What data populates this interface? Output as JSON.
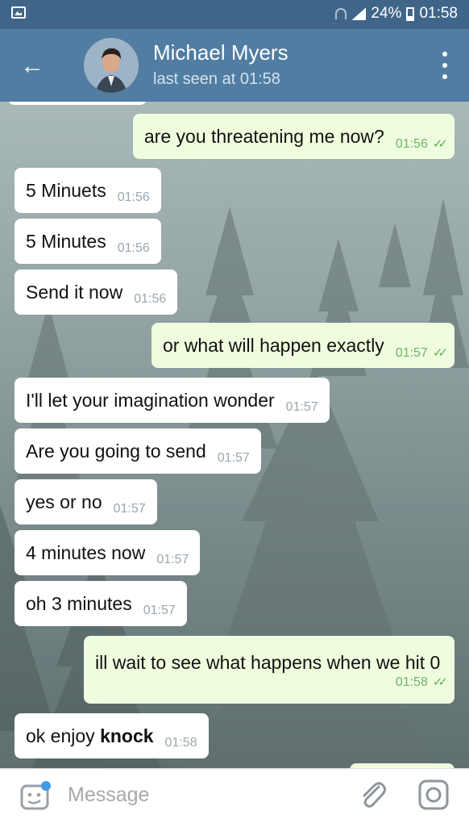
{
  "status_bar": {
    "battery": "24%",
    "time": "01:58"
  },
  "header": {
    "name": "Michael Myers",
    "status": "last seen at 01:58"
  },
  "messages": [
    {
      "dir": "out",
      "text": "are you threatening me now?",
      "time": "01:56"
    },
    {
      "dir": "in",
      "text": "5 Minuets",
      "time": "01:56"
    },
    {
      "dir": "in",
      "text": "5 Minutes",
      "time": "01:56"
    },
    {
      "dir": "in",
      "text": "Send it now",
      "time": "01:56"
    },
    {
      "dir": "out",
      "text": "or what will happen exactly",
      "time": "01:57"
    },
    {
      "dir": "in",
      "text": "I'll let your imagination wonder",
      "time": "01:57"
    },
    {
      "dir": "in",
      "text": "Are you going to send",
      "time": "01:57"
    },
    {
      "dir": "in",
      "text": "yes or no",
      "time": "01:57"
    },
    {
      "dir": "in",
      "text": "4 minutes now",
      "time": "01:57"
    },
    {
      "dir": "in",
      "text": "oh 3 minutes",
      "time": "01:57"
    },
    {
      "dir": "out",
      "text": "ill wait to see what happens when we hit 0",
      "time": "01:58"
    },
    {
      "dir": "in",
      "text_prefix": "ok enjoy",
      "text_bold": "knock",
      "time": "01:58"
    }
  ],
  "input": {
    "placeholder": "Message"
  },
  "icons": {
    "back": "arrow-left-icon",
    "more": "more-vertical-icon",
    "sticker": "sticker-icon",
    "attach": "paperclip-icon",
    "camera": "camera-icon",
    "read": "double-check-icon"
  },
  "colors": {
    "header": "#517da2",
    "status_bar": "#3f6589",
    "outgoing_bubble": "#effdde",
    "incoming_bubble": "#ffffff",
    "read_check": "#5fae5b"
  }
}
